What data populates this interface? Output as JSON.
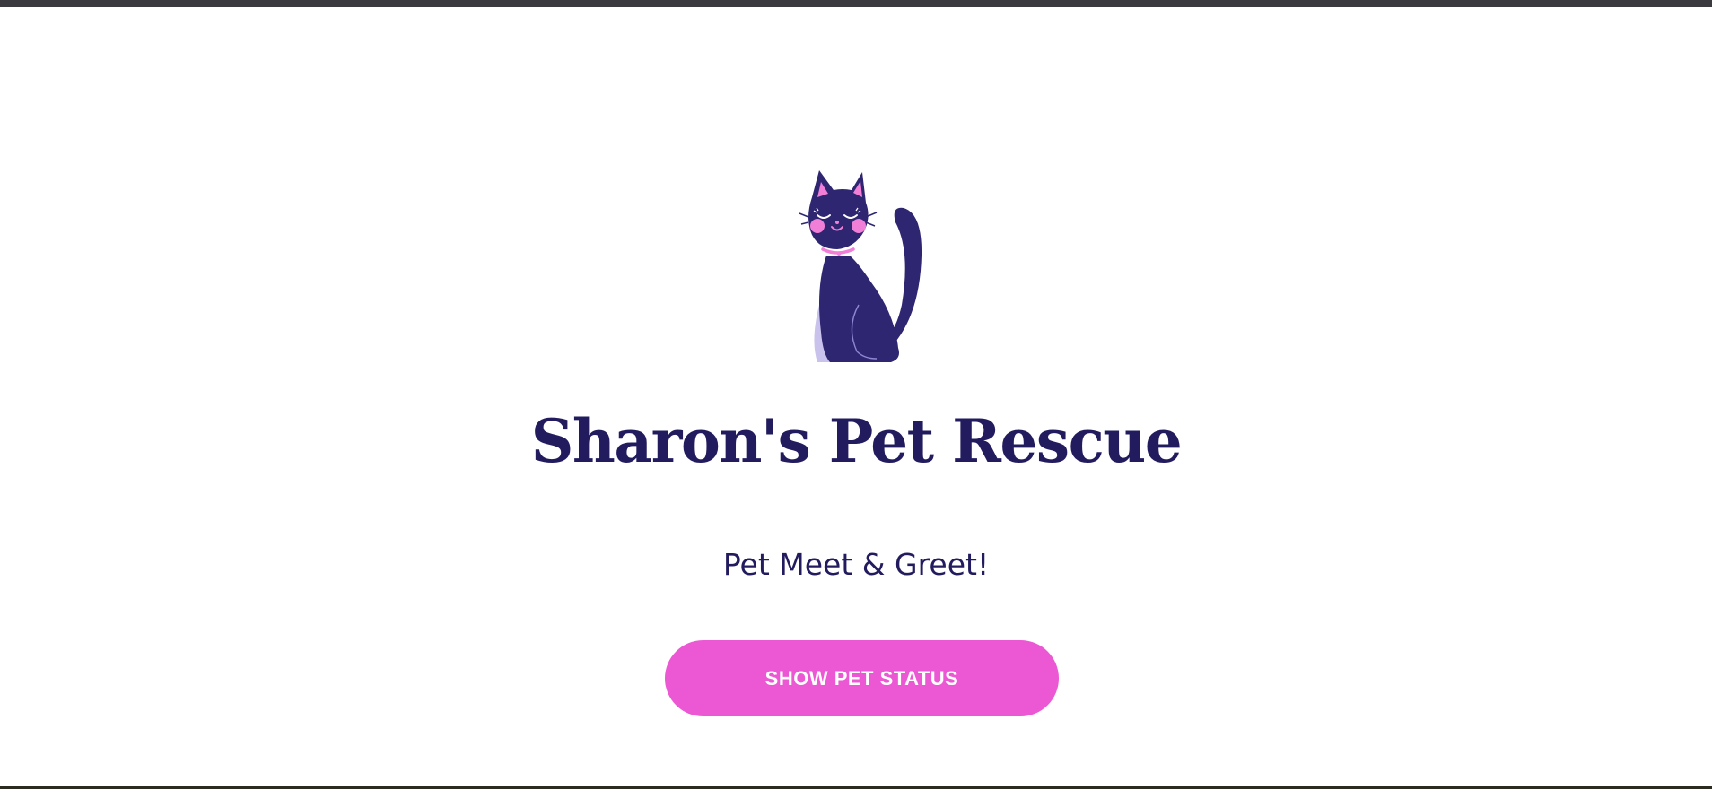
{
  "brand": {
    "logo_icon": "cat-icon",
    "title": "Sharon's Pet Rescue",
    "subtitle": "Pet Meet & Greet!"
  },
  "actions": {
    "show_status_label": "SHOW PET STATUS"
  },
  "colors": {
    "primary_text": "#221c5e",
    "cat_body": "#2e2671",
    "accent_pink": "#ec58d4",
    "background": "#ffffff"
  }
}
